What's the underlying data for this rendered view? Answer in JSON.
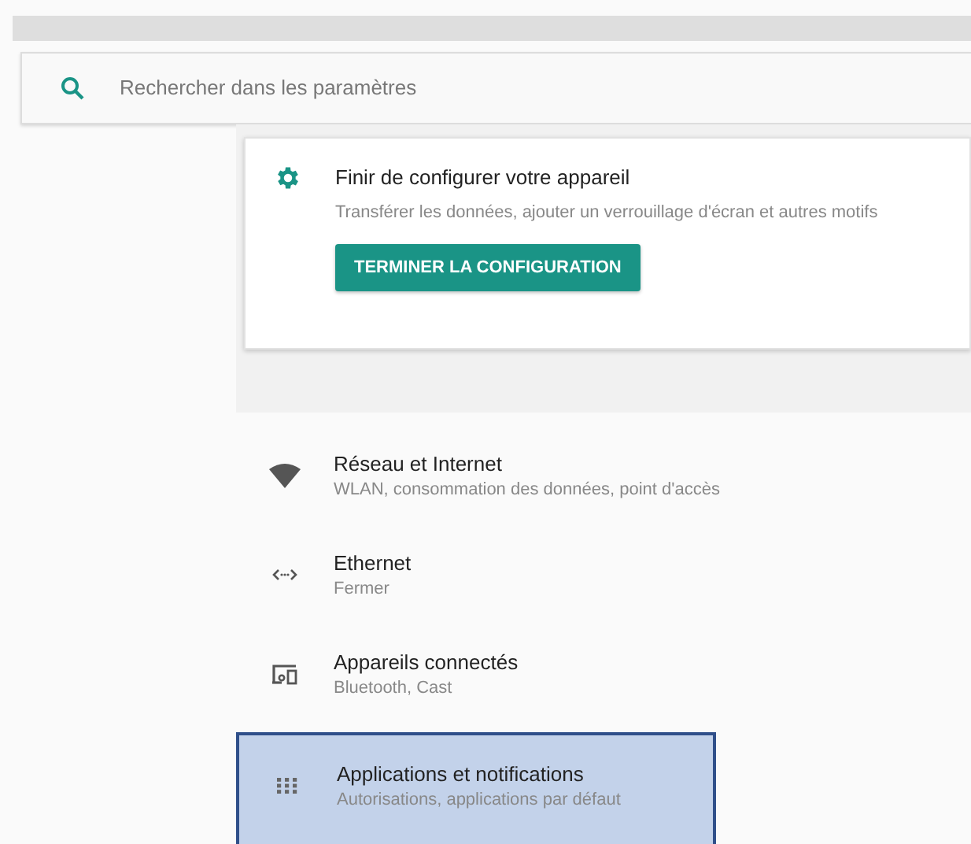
{
  "search": {
    "placeholder": "Rechercher dans les paramètres"
  },
  "setup_card": {
    "title": "Finir de configurer votre appareil",
    "description": "Transférer les données, ajouter un verrouillage d'écran et autres motifs",
    "button": "TERMINER LA CONFIGURATION"
  },
  "settings_items": [
    {
      "kind": "wifi",
      "title": "Réseau et Internet",
      "subtitle": "WLAN, consommation des données, point d'accès",
      "selected": false
    },
    {
      "kind": "ethernet",
      "title": "Ethernet",
      "subtitle": "Fermer",
      "selected": false
    },
    {
      "kind": "devices",
      "title": "Appareils connectés",
      "subtitle": "Bluetooth, Cast",
      "selected": false
    },
    {
      "kind": "apps",
      "title": "Applications et notifications",
      "subtitle": "Autorisations, applications par défaut",
      "selected": true
    }
  ]
}
